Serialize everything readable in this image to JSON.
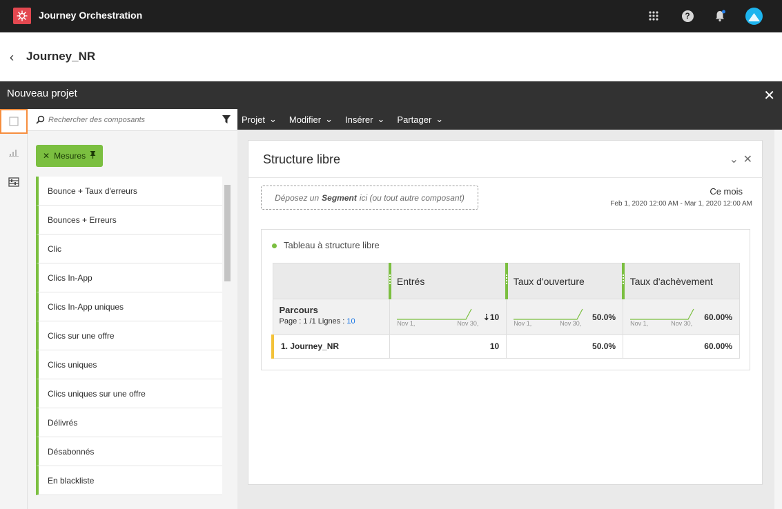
{
  "app": {
    "title": "Journey Orchestration"
  },
  "header": {
    "journey_title": "Journey_NR"
  },
  "project": {
    "title": "Nouveau projet"
  },
  "panel": {
    "search_placeholder": "Rechercher des composants",
    "filter_chip": "Mesures",
    "metrics": [
      "Bounce + Taux d'erreurs",
      "Bounces + Erreurs",
      "Clic",
      "Clics In-App",
      "Clics In-App uniques",
      "Clics sur une offre",
      "Clics uniques",
      "Clics uniques sur une offre",
      "Délivrés",
      "Désabonnés",
      "En blackliste"
    ]
  },
  "menu": [
    "Projet",
    "Modifier",
    "Insérer",
    "Partager"
  ],
  "card": {
    "title": "Structure libre",
    "dropzone": {
      "prefix": "Déposez un",
      "bold": "Segment",
      "suffix": "ici (ou tout autre composant)"
    },
    "date_title": "Ce mois",
    "date_range": "Feb 1, 2020 12:00 AM - Mar 1, 2020 12:00 AM",
    "table_title": "Tableau à structure libre",
    "table": {
      "columns": [
        "Entrés",
        "Taux d'ouverture",
        "Taux d'achèvement"
      ],
      "dimension": "Parcours",
      "page_prefix": "Page : 1 /1  Lignes : ",
      "rows_count": "10",
      "spark_start": "Nov 1,",
      "spark_end": "Nov 30,",
      "totals": [
        "10",
        "50.0%",
        "60.00%"
      ],
      "rows": [
        {
          "label": "1.  Journey_NR",
          "values": [
            "10",
            "50.0%",
            "60.00%"
          ]
        }
      ]
    }
  },
  "colors": {
    "accent_green": "#7bbf40",
    "highlight_orange": "#f68d3d",
    "brand_red": "#e34850"
  },
  "icons": [
    "app-logo-icon",
    "apps-grid-icon",
    "help-icon",
    "bell-icon",
    "avatar",
    "back-chevron-icon",
    "close-icon",
    "panels-icon",
    "metrics-icon",
    "visualizations-icon",
    "search-icon",
    "filter-icon",
    "pin-icon",
    "chevron-down-icon"
  ]
}
